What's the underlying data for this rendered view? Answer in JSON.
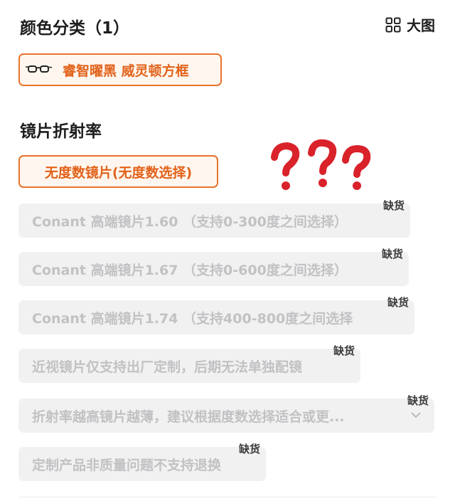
{
  "color_section": {
    "title": "颜色分类（1）",
    "view_toggle_label": "大图",
    "selected_option": "睿智曜黑 威灵顿方框",
    "thumb_icon": "glasses-icon"
  },
  "lens_section": {
    "title": "镜片折射率",
    "selected_option": "无度数镜片(无度数选择)",
    "options": [
      {
        "label": "Conant 高端镜片1.60 （支持0-300度之间选择）",
        "badge": "缺货"
      },
      {
        "label": "Conant 高端镜片1.67 （支持0-600度之间选择）",
        "badge": "缺货"
      },
      {
        "label": "Conant 高端镜片1.74 （支持400-800度之间选择",
        "badge": "缺货"
      },
      {
        "label": "近视镜片仅支持出厂定制，后期无法单独配镜",
        "badge": "缺货"
      },
      {
        "label": "折射率越高镜片越薄，建议根据度数选择适合或更...",
        "badge": "缺货"
      },
      {
        "label": "定制产品非质量问题不支持退换",
        "badge": "缺货"
      }
    ]
  },
  "colors": {
    "accent": "#e8732a",
    "accent_bg": "#fff7ef",
    "disabled_bg": "#f1f1f2",
    "disabled_text": "#c2c2c4",
    "question_marks": "#d9222a"
  }
}
